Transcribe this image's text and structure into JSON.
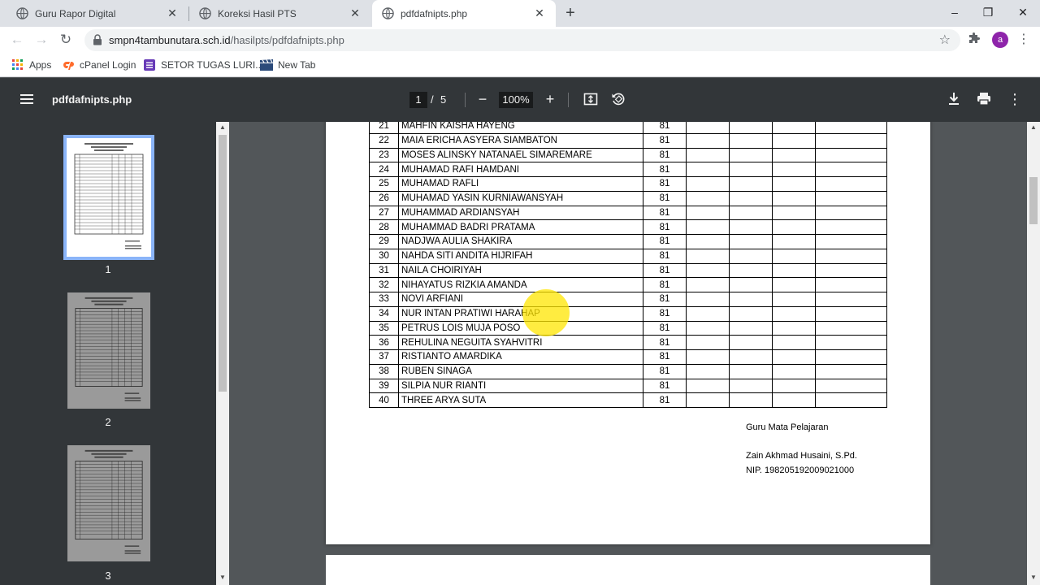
{
  "browser": {
    "tabs": [
      {
        "title": "Guru Rapor Digital",
        "active": false
      },
      {
        "title": "Koreksi Hasil PTS",
        "active": false
      },
      {
        "title": "pdfdafnipts.php",
        "active": true
      }
    ],
    "new_tab_symbol": "+",
    "window_controls": {
      "minimize": "–",
      "maximize": "❐",
      "close": "✕"
    },
    "url_host": "smpn4tambunutara.sch.id",
    "url_path": "/hasilpts/pdfdafnipts.php",
    "avatar_letter": "a",
    "bookmarks": [
      {
        "label": "Apps",
        "icon": "apps-grid-icon"
      },
      {
        "label": "cPanel Login",
        "icon": "cpanel-icon"
      },
      {
        "label": "SETOR TUGAS LURI...",
        "icon": "form-icon"
      },
      {
        "label": "New Tab",
        "icon": "clapper-icon"
      }
    ]
  },
  "pdf_toolbar": {
    "title": "pdfdafnipts.php",
    "current_page": "1",
    "page_separator": "/",
    "total_pages": "5",
    "zoom": "100%",
    "zoom_out_symbol": "−",
    "zoom_in_symbol": "+"
  },
  "thumbnails": [
    {
      "label": "1",
      "selected": true
    },
    {
      "label": "2",
      "selected": false
    },
    {
      "label": "3",
      "selected": false
    }
  ],
  "students": [
    {
      "no": "21",
      "name": "MAHFIN KAISHA HAYENG",
      "score": "81"
    },
    {
      "no": "22",
      "name": "MAIA ERICHA ASYERA SIAMBATON",
      "score": "81"
    },
    {
      "no": "23",
      "name": "MOSES ALINSKY NATANAEL SIMAREMARE",
      "score": "81"
    },
    {
      "no": "24",
      "name": "MUHAMAD RAFI HAMDANI",
      "score": "81"
    },
    {
      "no": "25",
      "name": "MUHAMAD RAFLI",
      "score": "81"
    },
    {
      "no": "26",
      "name": "MUHAMAD YASIN KURNIAWANSYAH",
      "score": "81"
    },
    {
      "no": "27",
      "name": "MUHAMMAD ARDIANSYAH",
      "score": "81"
    },
    {
      "no": "28",
      "name": "MUHAMMAD BADRI PRATAMA",
      "score": "81"
    },
    {
      "no": "29",
      "name": "NADJWA AULIA SHAKIRA",
      "score": "81"
    },
    {
      "no": "30",
      "name": "NAHDA SITI ANDITA HIJRIFAH",
      "score": "81"
    },
    {
      "no": "31",
      "name": "NAILA CHOIRIYAH",
      "score": "81"
    },
    {
      "no": "32",
      "name": "NIHAYATUS RIZKIA AMANDA",
      "score": "81"
    },
    {
      "no": "33",
      "name": "NOVI ARFIANI",
      "score": "81"
    },
    {
      "no": "34",
      "name": "NUR INTAN PRATIWI HARAHAP",
      "score": "81"
    },
    {
      "no": "35",
      "name": "PETRUS LOIS MUJA POSO",
      "score": "81"
    },
    {
      "no": "36",
      "name": "REHULINA NEGUITA SYAHVITRI",
      "score": "81"
    },
    {
      "no": "37",
      "name": "RISTIANTO AMARDIKA",
      "score": "81"
    },
    {
      "no": "38",
      "name": "RUBEN SINAGA",
      "score": "81"
    },
    {
      "no": "39",
      "name": "SILPIA NUR RIANTI",
      "score": "81"
    },
    {
      "no": "40",
      "name": "THREE ARYA SUTA",
      "score": "81"
    }
  ],
  "signature": {
    "role": "Guru Mata Pelajaran",
    "name": "Zain Akhmad Husaini, S.Pd.",
    "nip": "NIP. 198205192009021000"
  },
  "colors": {
    "pdf_toolbar_bg": "#323639",
    "viewer_bg": "#525659",
    "selected_thumb_outline": "#8ab4f8",
    "cursor_highlight": "#ffe600",
    "avatar_bg": "#8e24aa"
  }
}
